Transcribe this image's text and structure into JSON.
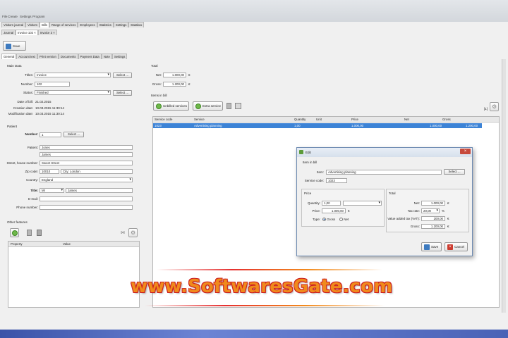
{
  "app": {
    "menu": [
      "File",
      "Create",
      "Settings",
      "Program"
    ]
  },
  "main_tabs": [
    "Visitors journal",
    "Visitors",
    "Bills",
    "Range of services",
    "Employees",
    "Statistics",
    "Settings",
    "Databox"
  ],
  "doc_tabs": [
    "Journal",
    "Invoice 102",
    "Invoice 3"
  ],
  "toolbar": {
    "save_label": "Save"
  },
  "section_tabs": [
    "General",
    "Account text",
    "Print version",
    "Documents",
    "Payment Data",
    "Note",
    "Settings"
  ],
  "main_data": {
    "heading": "Main Data",
    "titles_label": "Titles:",
    "titles_value": "Invoice",
    "number_label": "Number:",
    "number_value": "102",
    "status_label": "Status:",
    "status_value": "Finished",
    "date_label": "Date of bill:",
    "date_value": "21.02.2015",
    "creation_label": "Creation date:",
    "creation_value": "10.03.2015 11:30:14",
    "modification_label": "Modification date:",
    "modification_value": "10.03.2015 11:30:14",
    "select_label": "Select ..."
  },
  "patient": {
    "heading": "Patient",
    "number_label": "Number:",
    "number_value": "1",
    "patient_label": "Patient:",
    "first": "Jones",
    "second": "James",
    "street_label": "Street, house number:",
    "street_value": "Sweet Street",
    "zip_label": "Zip code:",
    "zip_value": "10010",
    "city_value": "City: London",
    "country_label": "Country:",
    "country_value": "England",
    "title_label": "Title:",
    "title_value": "Mr",
    "title_name": "James",
    "email_label": "E-mail:",
    "phone_label": "Phone number:",
    "select_label": "Select ..."
  },
  "other": {
    "heading": "Other features",
    "col_property": "Property",
    "col_value": "Value"
  },
  "total": {
    "heading": "Total",
    "net_label": "Net:",
    "net_value": "1.000,00",
    "gross_label": "Gross:",
    "gross_value": "1.200,00",
    "currency": "€"
  },
  "items": {
    "heading": "Items in bill",
    "unbilled_label": "Unbilled services",
    "extra_label": "Extra service",
    "count": "[1]",
    "columns": [
      "Service code",
      "Service",
      "Quantity",
      "Unit",
      "Price",
      "Net",
      "Gross"
    ],
    "rows": [
      [
        "1023",
        "Advertising planning",
        "1,00",
        "",
        "1.000,00",
        "1.000,00",
        "1.200,00"
      ]
    ]
  },
  "dialog": {
    "title": "Edit",
    "item_heading": "Item in bill",
    "item_label": "Item:",
    "item_value": "Advertising planning",
    "code_label": "Service code:",
    "code_value": "1023",
    "select_label": "Select ...",
    "price_heading": "Price",
    "qty_label": "Quantity:",
    "qty_value": "1,00",
    "price_label": "Price:",
    "price_value": "1.000,00",
    "type_label": "Type:",
    "gross_opt": "Gross",
    "net_opt": "Net",
    "total_heading": "Total",
    "net_label": "Net:",
    "net_value": "1.000,00",
    "tax_rate_label": "Tax rate:",
    "tax_rate_value": "20,00",
    "vat_label": "Value added tax (VAT):",
    "vat_value": "200,00",
    "gross_label": "Gross:",
    "gross_value": "1.200,00",
    "currency": "€",
    "percent": "%",
    "save_label": "Save",
    "cancel_label": "Cancel"
  },
  "watermark": "www.SoftwaresGate.com"
}
